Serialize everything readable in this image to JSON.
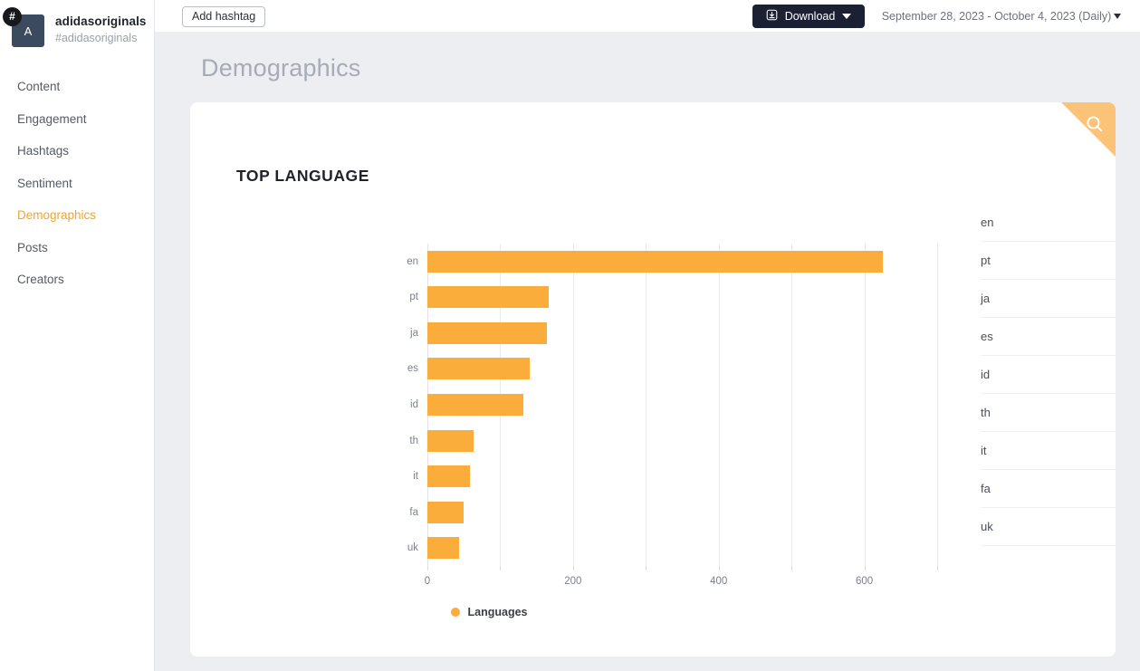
{
  "brand": {
    "avatar_initial": "A",
    "hash_badge": "#",
    "name": "adidasoriginals",
    "handle": "#adidasoriginals"
  },
  "sidebar": {
    "items": [
      {
        "label": "Content",
        "active": false
      },
      {
        "label": "Engagement",
        "active": false
      },
      {
        "label": "Hashtags",
        "active": false
      },
      {
        "label": "Sentiment",
        "active": false
      },
      {
        "label": "Demographics",
        "active": true
      },
      {
        "label": "Posts",
        "active": false
      },
      {
        "label": "Creators",
        "active": false
      }
    ]
  },
  "topbar": {
    "add_hashtag_label": "Add hashtag",
    "download_label": "Download",
    "date_range_label": "September 28, 2023 - October 4, 2023 (Daily)"
  },
  "page": {
    "title": "Demographics"
  },
  "card": {
    "title": "TOP LANGUAGE",
    "accent_color": "#FBAD3C",
    "corner_color": "#FAC378"
  },
  "chart_data": {
    "type": "bar",
    "orientation": "horizontal",
    "title": "TOP LANGUAGE",
    "categories": [
      "en",
      "pt",
      "ja",
      "es",
      "id",
      "th",
      "it",
      "fa",
      "uk"
    ],
    "values": [
      626,
      167,
      164,
      140,
      132,
      64,
      59,
      50,
      44
    ],
    "series": [
      {
        "name": "Languages",
        "values": [
          626,
          167,
          164,
          140,
          132,
          64,
          59,
          50,
          44
        ]
      }
    ],
    "xlabel": "",
    "ylabel": "",
    "xlim": [
      0,
      700
    ],
    "xticks": [
      0,
      200,
      400,
      600
    ],
    "xtick_labels": [
      "0",
      "200",
      "400",
      "600"
    ],
    "minor_gridlines": [
      0,
      100,
      200,
      300,
      400,
      500,
      600,
      700
    ],
    "grid": true,
    "legend": {
      "position": "bottom",
      "entries": [
        "Languages"
      ]
    },
    "bar_color": "#FBAD3C"
  },
  "table": {
    "rows": [
      {
        "key": "en",
        "value": "626"
      },
      {
        "key": "pt",
        "value": "167"
      },
      {
        "key": "ja",
        "value": "164"
      },
      {
        "key": "es",
        "value": "140"
      },
      {
        "key": "id",
        "value": "132"
      },
      {
        "key": "th",
        "value": "64"
      },
      {
        "key": "it",
        "value": "59"
      },
      {
        "key": "fa",
        "value": "50"
      },
      {
        "key": "uk",
        "value": "44"
      }
    ]
  }
}
